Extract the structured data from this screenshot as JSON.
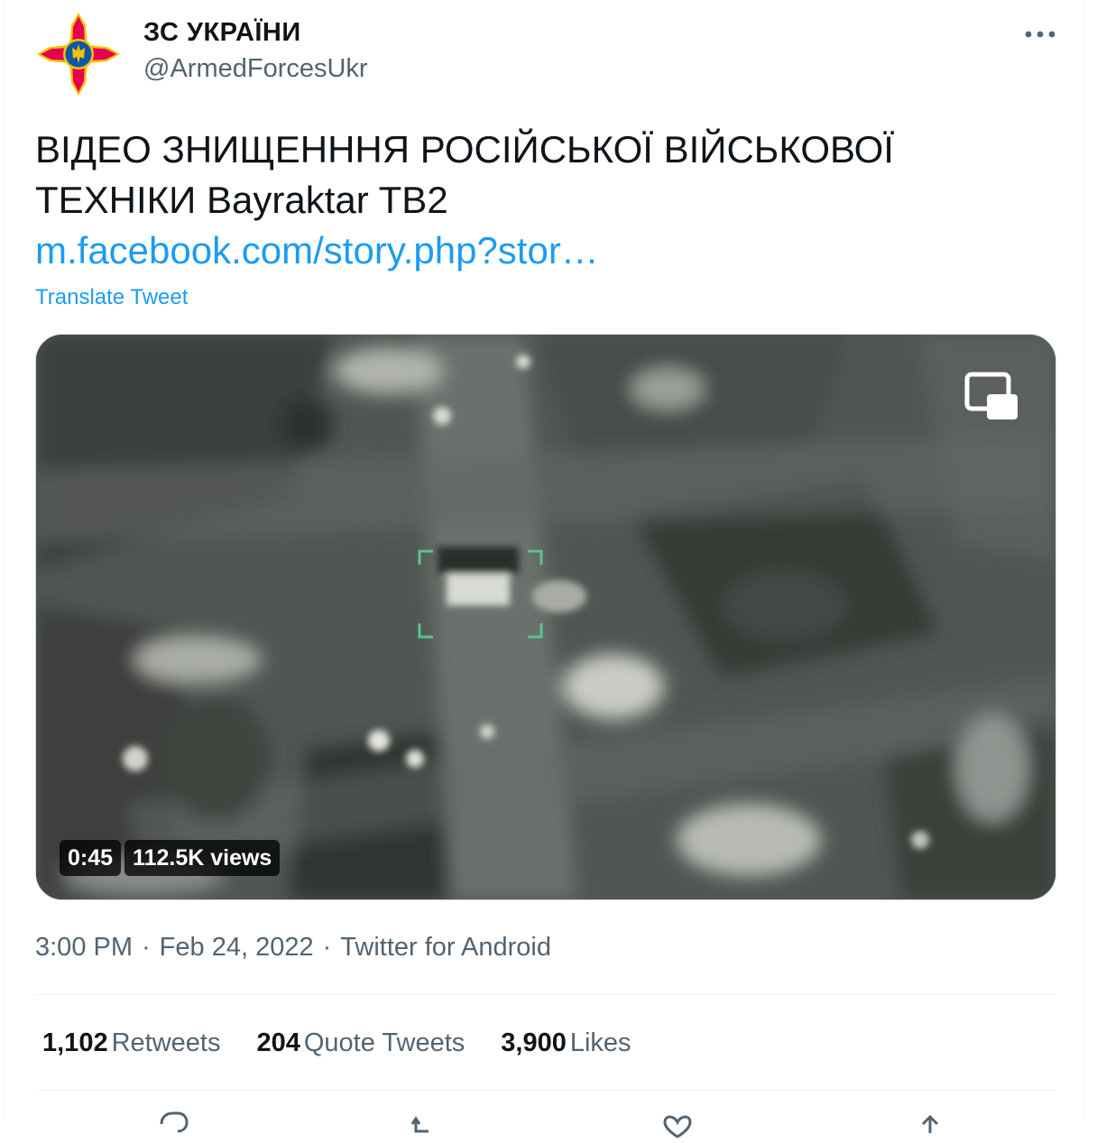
{
  "author": {
    "display_name": "ЗС УКРАЇНИ",
    "handle": "@ArmedForcesUkr",
    "avatar_icon": "armed-forces-cross-emblem"
  },
  "tweet": {
    "text": "ВІДЕО ЗНИЩЕНННЯ РОСІЙСЬКОЇ ВІЙСЬКОВОЇ ТЕХНІКИ Bayraktar TB2",
    "link": "m.facebook.com/story.php?stor…",
    "translate_label": "Translate Tweet"
  },
  "media": {
    "type": "video",
    "duration": "0:45",
    "views": "112.5K views",
    "pip_icon": "picture-in-picture-icon"
  },
  "meta": {
    "time": "3:00 PM",
    "separator": "·",
    "date": "Feb 24, 2022",
    "source": "Twitter for Android"
  },
  "stats": [
    {
      "count": "1,102",
      "label": "Retweets"
    },
    {
      "count": "204",
      "label": "Quote Tweets"
    },
    {
      "count": "3,900",
      "label": "Likes"
    }
  ],
  "actions": [
    "reply-icon",
    "retweet-icon",
    "like-icon",
    "share-icon"
  ],
  "colors": {
    "link": "#1d9bf0",
    "secondary_text": "#536471",
    "primary_text": "#0f1419",
    "emblem_red": "#e4004f",
    "emblem_blue": "#0d57a7",
    "emblem_gold": "#f2c200"
  }
}
